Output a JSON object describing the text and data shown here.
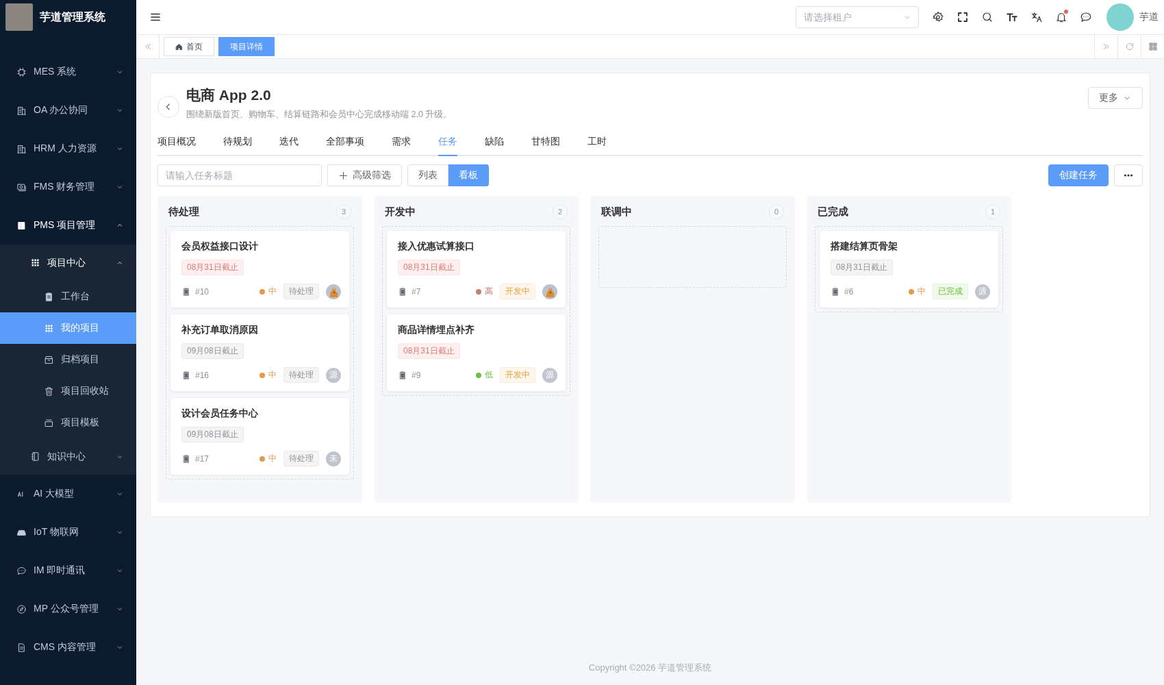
{
  "app": {
    "name": "芋道管理系统"
  },
  "sidebar": {
    "items": [
      {
        "label": "MES 系统",
        "selected": false,
        "expanded": false
      },
      {
        "label": "OA 办公协同",
        "selected": false,
        "expanded": false
      },
      {
        "label": "HRM 人力资源",
        "selected": false,
        "expanded": false
      },
      {
        "label": "FMS 财务管理",
        "selected": false,
        "expanded": false
      },
      {
        "label": "PMS 项目管理",
        "selected": false,
        "expanded": true,
        "children": [
          {
            "label": "项目中心",
            "selected": false,
            "expanded": true,
            "children": [
              {
                "label": "工作台",
                "selected": false
              },
              {
                "label": "我的项目",
                "selected": true
              },
              {
                "label": "归档项目",
                "selected": false
              },
              {
                "label": "项目回收站",
                "selected": false
              },
              {
                "label": "项目模板",
                "selected": false
              }
            ]
          },
          {
            "label": "知识中心",
            "selected": false,
            "expanded": false
          }
        ]
      },
      {
        "label": "AI 大模型",
        "selected": false,
        "expanded": false
      },
      {
        "label": "IoT 物联网",
        "selected": false,
        "expanded": false
      },
      {
        "label": "IM 即时通讯",
        "selected": false,
        "expanded": false
      },
      {
        "label": "MP 公众号管理",
        "selected": false,
        "expanded": false
      },
      {
        "label": "CMS 内容管理",
        "selected": false,
        "expanded": false
      }
    ]
  },
  "header": {
    "tenant_select": {
      "placeholder": "请选择租户"
    },
    "notifications_unread": true,
    "user_name": "芋道"
  },
  "page_tabs": [
    {
      "label": "首页",
      "selected": false
    },
    {
      "label": "项目详情",
      "selected": true
    }
  ],
  "project": {
    "title": "电商 App 2.0",
    "description": "围绕新版首页、购物车、结算链路和会员中心完成移动端 2.0 升级。",
    "more_button": "更多",
    "tabs": [
      {
        "label": "项目概况",
        "selected": false
      },
      {
        "label": "待规划",
        "selected": false
      },
      {
        "label": "迭代",
        "selected": false
      },
      {
        "label": "全部事项",
        "selected": false
      },
      {
        "label": "需求",
        "selected": false
      },
      {
        "label": "任务",
        "selected": true
      },
      {
        "label": "缺陷",
        "selected": false
      },
      {
        "label": "甘特图",
        "selected": false
      },
      {
        "label": "工时",
        "selected": false
      }
    ],
    "search": {
      "placeholder": "请输入任务标题"
    },
    "filter_button": "高级筛选",
    "view_toggle": [
      {
        "label": "列表",
        "selected": false
      },
      {
        "label": "看板",
        "selected": true
      }
    ],
    "create_button": "创建任务"
  },
  "board": {
    "columns": [
      {
        "title": "待处理",
        "count": "3",
        "cards": [
          {
            "title": "会员权益接口设计",
            "deadline": "08月31日截止",
            "overdue": true,
            "number": "#10",
            "priority": {
              "label": "中",
              "color": "#e39a4f"
            },
            "status": {
              "label": "待处理",
              "kind": "pending"
            },
            "assignee": {
              "kind": "image"
            }
          },
          {
            "title": "补充订单取消原因",
            "deadline": "09月08日截止",
            "overdue": false,
            "number": "#16",
            "priority": {
              "label": "中",
              "color": "#e39a4f"
            },
            "status": {
              "label": "待处理",
              "kind": "pending"
            },
            "assignee": {
              "kind": "text",
              "initial": "源"
            }
          },
          {
            "title": "设计会员任务中心",
            "deadline": "09月08日截止",
            "overdue": false,
            "number": "#17",
            "priority": {
              "label": "中",
              "color": "#e39a4f"
            },
            "status": {
              "label": "待处理",
              "kind": "pending"
            },
            "assignee": {
              "kind": "text",
              "initial": "未"
            }
          }
        ]
      },
      {
        "title": "开发中",
        "count": "2",
        "cards": [
          {
            "title": "接入优惠试算接口",
            "deadline": "08月31日截止",
            "overdue": true,
            "number": "#7",
            "priority": {
              "label": "高",
              "color": "#c97e74"
            },
            "status": {
              "label": "开发中",
              "kind": "progress"
            },
            "assignee": {
              "kind": "image"
            }
          },
          {
            "title": "商品详情埋点补齐",
            "deadline": "08月31日截止",
            "overdue": true,
            "number": "#9",
            "priority": {
              "label": "低",
              "color": "#6cc04a"
            },
            "status": {
              "label": "开发中",
              "kind": "progress"
            },
            "assignee": {
              "kind": "text",
              "initial": "源"
            }
          }
        ]
      },
      {
        "title": "联调中",
        "count": "0"
      },
      {
        "title": "已完成",
        "count": "1",
        "cards": [
          {
            "title": "搭建结算页骨架",
            "deadline": "08月31日截止",
            "overdue": false,
            "number": "#6",
            "priority": {
              "label": "中",
              "color": "#e39a4f"
            },
            "status": {
              "label": "已完成",
              "kind": "done"
            },
            "assignee": {
              "kind": "text",
              "initial": "源"
            }
          }
        ]
      }
    ]
  },
  "footer": "Copyright ©2026 芋道管理系统"
}
